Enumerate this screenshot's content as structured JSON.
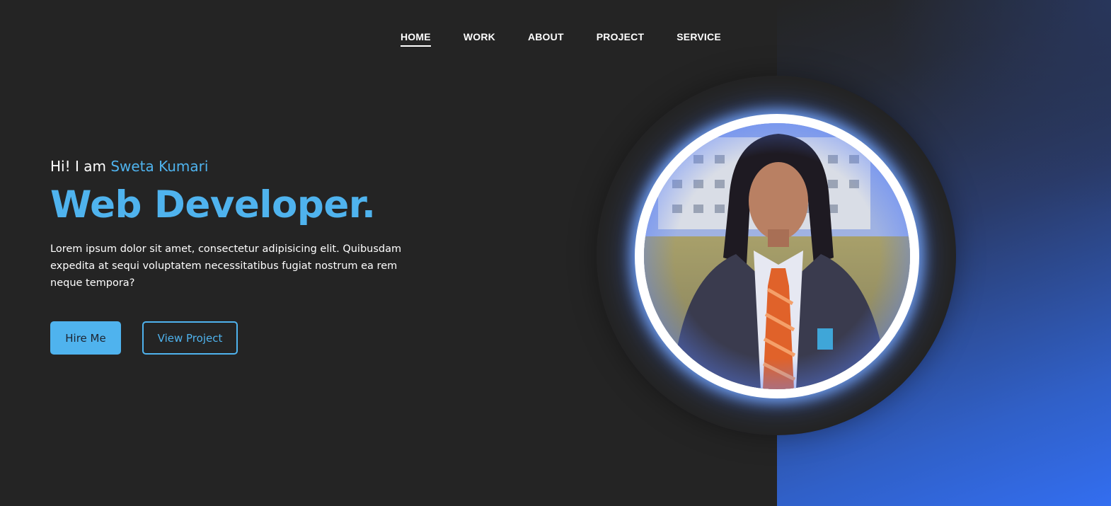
{
  "nav": {
    "items": [
      {
        "label": "HOME",
        "active": true
      },
      {
        "label": "WORK",
        "active": false
      },
      {
        "label": "ABOUT",
        "active": false
      },
      {
        "label": "PROJECT",
        "active": false
      },
      {
        "label": "SERVICE",
        "active": false
      }
    ]
  },
  "hero": {
    "greeting_prefix": "Hi! I am ",
    "name": "Sweta Kumari",
    "role": "Web Developer.",
    "description": "Lorem ipsum dolor sit amet, consectetur adipisicing elit. Quibusdam expedita at sequi voluptatem necessitatibus fugiat nostrum ea rem neque tempora?",
    "hire_label": "Hire Me",
    "view_project_label": "View Project"
  },
  "colors": {
    "background": "#242424",
    "accent": "#4fb3ee",
    "gradient_end": "#336ef0"
  },
  "icons": {
    "profile": "profile-photo"
  }
}
